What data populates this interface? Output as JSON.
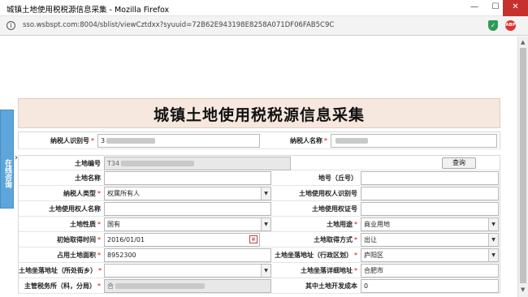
{
  "window": {
    "title": "城镇土地使用税税源信息采集 - Mozilla Firefox",
    "minimize": "—",
    "maximize": "☐",
    "close": "✕"
  },
  "browser": {
    "url": "sso.wsbspt.com:8004/sblist/viewCztdxx?syuuid=72B62E943198E8258A071DF06FAB5C9C",
    "abp_label": "ABP"
  },
  "side_tab": {
    "label": "在线咨询"
  },
  "page": {
    "title": "城镇土地使用税税源信息采集"
  },
  "taxpayer": {
    "id_label": "纳税人识别号",
    "id_value": "3",
    "name_label": "纳税人名称",
    "name_value": ""
  },
  "form": {
    "land_no_label": "土地编号",
    "land_no_value": "T34",
    "query_button": "查询",
    "land_name_label": "土地名称",
    "land_name_value": "",
    "parcel_no_label": "地号（丘号）",
    "parcel_no_value": "",
    "taxpayer_type_label": "纳税人类型",
    "taxpayer_type_value": "权属所有人",
    "user_id_label": "土地使用权人识别号",
    "user_id_value": "",
    "user_name_label": "土地使用权人名称",
    "user_name_value": "",
    "cert_no_label": "土地使用权证号",
    "cert_no_value": "",
    "nature_label": "土地性质",
    "nature_value": "国有",
    "usage_label": "土地用途",
    "usage_value": "商业用地",
    "acquire_time_label": "初始取得时间",
    "acquire_time_value": "2016/01/01",
    "acquire_method_label": "土地取得方式",
    "acquire_method_value": "出让",
    "area_label": "占用土地面积",
    "area_value": "8952300",
    "district_label": "土地坐落地址（行政区划）",
    "district_value": "庐阳区",
    "street_label": "土地坐落地址（所处街乡）",
    "street_value": "",
    "detail_addr_label": "土地坐落详细地址",
    "detail_addr_value": "合肥市",
    "tax_office_label": "主管税务所（科，分局）",
    "tax_office_value": "合",
    "dev_cost_label": "其中土地开发成本",
    "dev_cost_value": "0"
  },
  "colors": {
    "header_bg": "#f6e8de",
    "required": "#d00",
    "close_button": "#c7312d",
    "side_tab": "#5da5db"
  }
}
